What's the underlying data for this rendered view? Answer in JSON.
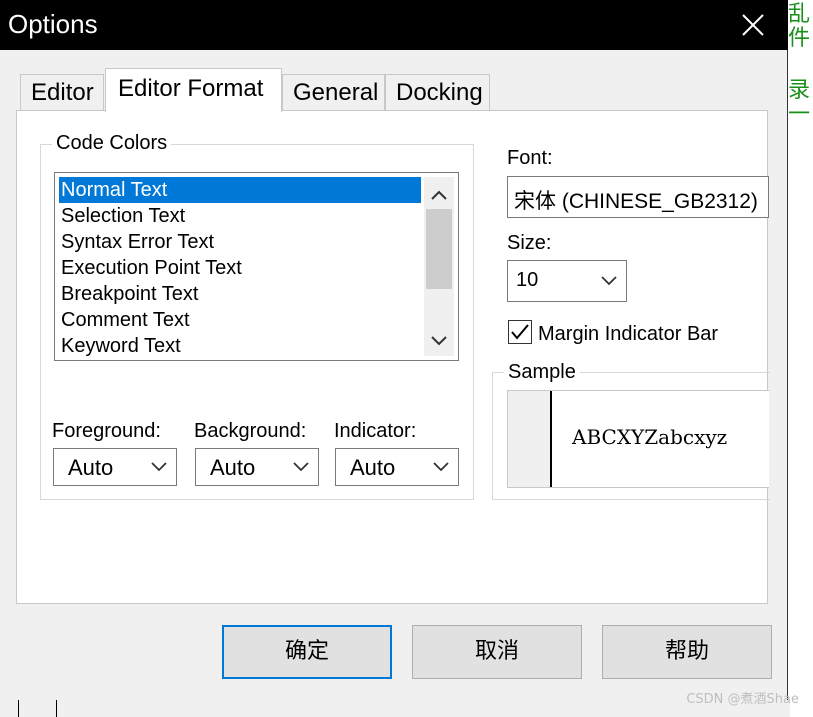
{
  "window": {
    "title": "Options"
  },
  "tabs": [
    {
      "label": "Editor"
    },
    {
      "label": "Editor Format"
    },
    {
      "label": "General"
    },
    {
      "label": "Docking"
    }
  ],
  "code_colors": {
    "label": "Code Colors",
    "items": [
      "Normal Text",
      "Selection Text",
      "Syntax Error Text",
      "Execution Point Text",
      "Breakpoint Text",
      "Comment Text",
      "Keyword Text"
    ],
    "selected": "Normal Text",
    "foreground": {
      "label": "Foreground:",
      "value": "Auto"
    },
    "background": {
      "label": "Background:",
      "value": "Auto"
    },
    "indicator": {
      "label": "Indicator:",
      "value": "Auto"
    }
  },
  "font": {
    "label": "Font:",
    "value": "宋体 (CHINESE_GB2312)"
  },
  "size": {
    "label": "Size:",
    "value": "10"
  },
  "margin_indicator": {
    "label": "Margin Indicator Bar",
    "checked": true
  },
  "sample": {
    "label": "Sample",
    "text": "ABCXYZabcxyz"
  },
  "buttons": {
    "ok": "确定",
    "cancel": "取消",
    "help": "帮助"
  },
  "background_text": {
    "line1": "乱",
    "line2": "件",
    "line3": "录",
    "line4": "一"
  },
  "watermark": "CSDN @煮酒Shae",
  "colors": {
    "selection": "#0078d7",
    "titlebar": "#000000",
    "background_text": "#1a8f1a"
  }
}
